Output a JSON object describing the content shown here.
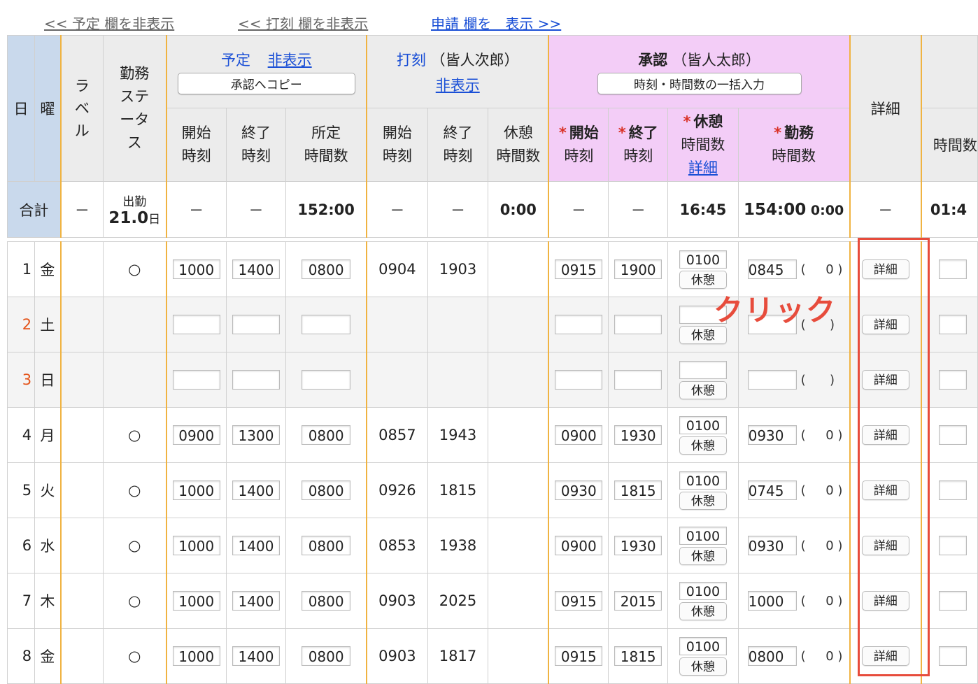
{
  "toplinks": {
    "hide_schedule": "<< 予定 欄を非表示",
    "hide_stamp": "<< 打刻 欄を非表示",
    "show_request": "申請 欄を　表示 >>"
  },
  "header": {
    "day": "日",
    "weekday": "曜",
    "label": "ラベル",
    "status": "勤務ステータス",
    "schedule_title": "予定",
    "schedule_hide": "非表示",
    "copy_button": "承認へコピー",
    "stamp_title": "打刻",
    "stamp_person": "（皆人次郎）",
    "stamp_hide": "非表示",
    "approval_title": "承認",
    "approval_person": "（皆人太郎）",
    "bulk_button": "時刻・時間数の一括入力",
    "detail": "詳細",
    "extra": "時間数",
    "sub": {
      "start": [
        "開始",
        "時刻"
      ],
      "end": [
        "終了",
        "時刻"
      ],
      "scheduled_hours": [
        "所定",
        "時間数"
      ],
      "break_hours": [
        "休憩",
        "時間数"
      ],
      "work_hours": [
        "勤務",
        "時間数"
      ],
      "break_detail": "詳細",
      "required_mark": "*"
    }
  },
  "totals": {
    "label": "合計",
    "dash": "－",
    "attendance_label": "出勤",
    "attendance_value": "21.0",
    "attendance_unit": "日",
    "scheduled_hours": "152:00",
    "stamp_break": "0:00",
    "approval_break": "16:45",
    "approval_work": "154:00",
    "approval_work_sub": "0:00",
    "extra": "01:4"
  },
  "buttons": {
    "detail": "詳細",
    "break": "休憩"
  },
  "rows": [
    {
      "day": "1",
      "wd": "金",
      "status": "○",
      "s_start": "1000",
      "s_end": "1400",
      "s_hours": "0800",
      "t_start": "0904",
      "t_end": "1903",
      "a_start": "0915",
      "a_end": "1900",
      "a_break": "0100",
      "a_work": "0845",
      "paren": "0"
    },
    {
      "day": "2",
      "wd": "土",
      "status": "",
      "s_start": "",
      "s_end": "",
      "s_hours": "",
      "t_start": "",
      "t_end": "",
      "a_start": "",
      "a_end": "",
      "a_break": "",
      "a_work": "",
      "paren": ""
    },
    {
      "day": "3",
      "wd": "日",
      "status": "",
      "s_start": "",
      "s_end": "",
      "s_hours": "",
      "t_start": "",
      "t_end": "",
      "a_start": "",
      "a_end": "",
      "a_break": "",
      "a_work": "",
      "paren": ""
    },
    {
      "day": "4",
      "wd": "月",
      "status": "○",
      "s_start": "0900",
      "s_end": "1300",
      "s_hours": "0800",
      "t_start": "0857",
      "t_end": "1943",
      "a_start": "0900",
      "a_end": "1930",
      "a_break": "0100",
      "a_work": "0930",
      "paren": "0"
    },
    {
      "day": "5",
      "wd": "火",
      "status": "○",
      "s_start": "1000",
      "s_end": "1400",
      "s_hours": "0800",
      "t_start": "0926",
      "t_end": "1815",
      "a_start": "0930",
      "a_end": "1815",
      "a_break": "0100",
      "a_work": "0745",
      "paren": "0"
    },
    {
      "day": "6",
      "wd": "水",
      "status": "○",
      "s_start": "1000",
      "s_end": "1400",
      "s_hours": "0800",
      "t_start": "0853",
      "t_end": "1938",
      "a_start": "0900",
      "a_end": "1930",
      "a_break": "0100",
      "a_work": "0930",
      "paren": "0"
    },
    {
      "day": "7",
      "wd": "木",
      "status": "○",
      "s_start": "1000",
      "s_end": "1400",
      "s_hours": "0800",
      "t_start": "0903",
      "t_end": "2025",
      "a_start": "0915",
      "a_end": "2015",
      "a_break": "0100",
      "a_work": "1000",
      "paren": "0"
    },
    {
      "day": "8",
      "wd": "金",
      "status": "○",
      "s_start": "1000",
      "s_end": "1400",
      "s_hours": "0800",
      "t_start": "0903",
      "t_end": "1817",
      "a_start": "0915",
      "a_end": "1815",
      "a_break": "0100",
      "a_work": "0800",
      "paren": "0"
    }
  ],
  "annotation": {
    "click_label": "クリック",
    "color": "#e74c3c"
  }
}
